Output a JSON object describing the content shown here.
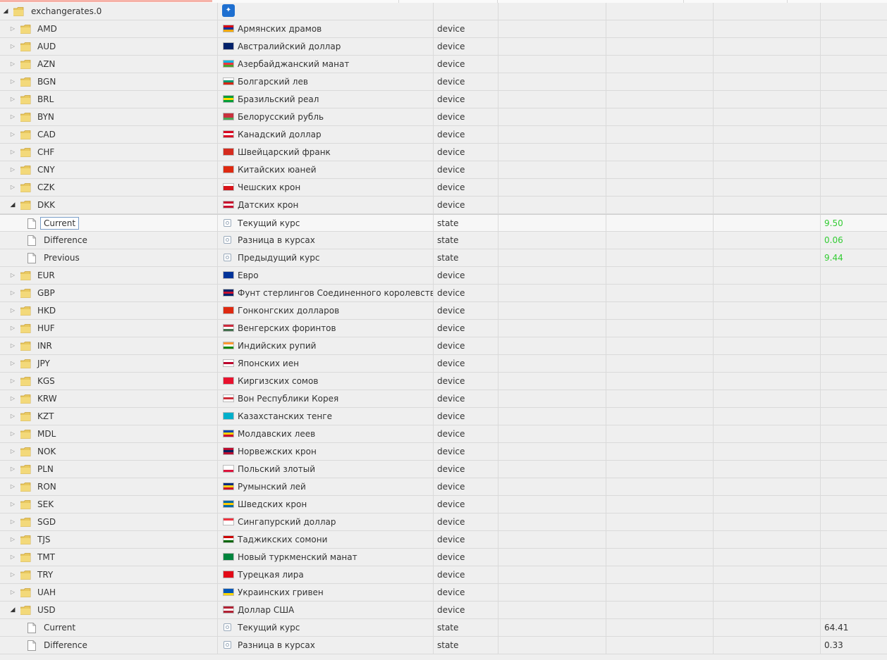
{
  "root": {
    "id": "exchangerates.0",
    "expanded": true
  },
  "colors": {
    "green_value": "#33cc33",
    "selection_border": "#7a9ec8"
  },
  "rows": [
    {
      "kind": "device",
      "id": "AMD",
      "name": "Армянских драмов",
      "type": "device",
      "flag": [
        "#d90012",
        "#0033a0",
        "#f2a800"
      ]
    },
    {
      "kind": "device",
      "id": "AUD",
      "name": "Австралийский доллар",
      "type": "device",
      "flag": [
        "#012169",
        "#012169",
        "#012169"
      ]
    },
    {
      "kind": "device",
      "id": "AZN",
      "name": "Азербайджанский манат",
      "type": "device",
      "flag": [
        "#00b5e2",
        "#ef3340",
        "#509e2f"
      ]
    },
    {
      "kind": "device",
      "id": "BGN",
      "name": "Болгарский лев",
      "type": "device",
      "flag": [
        "#ffffff",
        "#00966e",
        "#d62612"
      ]
    },
    {
      "kind": "device",
      "id": "BRL",
      "name": "Бразильский реал",
      "type": "device",
      "flag": [
        "#009c3b",
        "#ffdf00",
        "#009c3b"
      ]
    },
    {
      "kind": "device",
      "id": "BYN",
      "name": "Белорусский рубль",
      "type": "device",
      "flag": [
        "#c8313e",
        "#c8313e",
        "#4aa657"
      ]
    },
    {
      "kind": "device",
      "id": "CAD",
      "name": "Канадский доллар",
      "type": "device",
      "flag": [
        "#d80621",
        "#ffffff",
        "#d80621"
      ]
    },
    {
      "kind": "device",
      "id": "CHF",
      "name": "Швейцарский франк",
      "type": "device",
      "flag": [
        "#d52b1e",
        "#d52b1e",
        "#d52b1e"
      ]
    },
    {
      "kind": "device",
      "id": "CNY",
      "name": "Китайских юаней",
      "type": "device",
      "flag": [
        "#de2910",
        "#de2910",
        "#de2910"
      ]
    },
    {
      "kind": "device",
      "id": "CZK",
      "name": "Чешских крон",
      "type": "device",
      "flag": [
        "#ffffff",
        "#d7141a",
        "#d7141a"
      ]
    },
    {
      "kind": "device",
      "id": "DKK",
      "name": "Датских крон",
      "type": "device",
      "expanded": true,
      "flag": [
        "#c8102e",
        "#ffffff",
        "#c8102e"
      ]
    },
    {
      "kind": "state",
      "id": "Current",
      "name": "Текущий курс",
      "type": "state",
      "value": "9.50",
      "green": true,
      "selected": true
    },
    {
      "kind": "state",
      "id": "Difference",
      "name": "Разница в курсах",
      "type": "state",
      "value": "0.06",
      "green": true
    },
    {
      "kind": "state",
      "id": "Previous",
      "name": "Предыдущий курс",
      "type": "state",
      "value": "9.44",
      "green": true
    },
    {
      "kind": "device",
      "id": "EUR",
      "name": "Евро",
      "type": "device",
      "flag": [
        "#003399",
        "#003399",
        "#003399"
      ]
    },
    {
      "kind": "device",
      "id": "GBP",
      "name": "Фунт стерлингов Соединенного королевства",
      "type": "device",
      "flag": [
        "#012169",
        "#c8102e",
        "#012169"
      ]
    },
    {
      "kind": "device",
      "id": "HKD",
      "name": "Гонконгских долларов",
      "type": "device",
      "flag": [
        "#de2910",
        "#de2910",
        "#de2910"
      ]
    },
    {
      "kind": "device",
      "id": "HUF",
      "name": "Венгерских форинтов",
      "type": "device",
      "flag": [
        "#cd2a3e",
        "#ffffff",
        "#436f4d"
      ]
    },
    {
      "kind": "device",
      "id": "INR",
      "name": "Индийских рупий",
      "type": "device",
      "flag": [
        "#ff9933",
        "#ffffff",
        "#138808"
      ]
    },
    {
      "kind": "device",
      "id": "JPY",
      "name": "Японских иен",
      "type": "device",
      "flag": [
        "#ffffff",
        "#bc002d",
        "#ffffff"
      ]
    },
    {
      "kind": "device",
      "id": "KGS",
      "name": "Киргизских сомов",
      "type": "device",
      "flag": [
        "#e8112d",
        "#e8112d",
        "#e8112d"
      ]
    },
    {
      "kind": "device",
      "id": "KRW",
      "name": "Вон Республики Корея",
      "type": "device",
      "flag": [
        "#ffffff",
        "#cd2e3a",
        "#ffffff"
      ]
    },
    {
      "kind": "device",
      "id": "KZT",
      "name": "Казахстанских тенге",
      "type": "device",
      "flag": [
        "#00afca",
        "#00afca",
        "#00afca"
      ]
    },
    {
      "kind": "device",
      "id": "MDL",
      "name": "Молдавских леев",
      "type": "device",
      "flag": [
        "#0046ae",
        "#ffd200",
        "#cc092f"
      ]
    },
    {
      "kind": "device",
      "id": "NOK",
      "name": "Норвежских крон",
      "type": "device",
      "flag": [
        "#ba0c2f",
        "#00205b",
        "#ba0c2f"
      ]
    },
    {
      "kind": "device",
      "id": "PLN",
      "name": "Польский злотый",
      "type": "device",
      "flag": [
        "#ffffff",
        "#ffffff",
        "#dc143c"
      ]
    },
    {
      "kind": "device",
      "id": "RON",
      "name": "Румынский лей",
      "type": "device",
      "flag": [
        "#002b7f",
        "#fcd116",
        "#ce1126"
      ]
    },
    {
      "kind": "device",
      "id": "SEK",
      "name": "Шведских крон",
      "type": "device",
      "flag": [
        "#006aa7",
        "#fecc00",
        "#006aa7"
      ]
    },
    {
      "kind": "device",
      "id": "SGD",
      "name": "Сингапурский доллар",
      "type": "device",
      "flag": [
        "#ef3340",
        "#ffffff",
        "#ffffff"
      ]
    },
    {
      "kind": "device",
      "id": "TJS",
      "name": "Таджикских сомони",
      "type": "device",
      "flag": [
        "#cc0000",
        "#ffffff",
        "#006600"
      ]
    },
    {
      "kind": "device",
      "id": "TMT",
      "name": "Новый туркменский манат",
      "type": "device",
      "flag": [
        "#00843d",
        "#00843d",
        "#00843d"
      ]
    },
    {
      "kind": "device",
      "id": "TRY",
      "name": "Турецкая лира",
      "type": "device",
      "flag": [
        "#e30a17",
        "#e30a17",
        "#e30a17"
      ]
    },
    {
      "kind": "device",
      "id": "UAH",
      "name": "Украинских гривен",
      "type": "device",
      "flag": [
        "#0057b7",
        "#0057b7",
        "#ffd700"
      ]
    },
    {
      "kind": "device",
      "id": "USD",
      "name": "Доллар США",
      "type": "device",
      "expanded": true,
      "flag": [
        "#b22234",
        "#ffffff",
        "#b22234"
      ]
    },
    {
      "kind": "state",
      "id": "Current",
      "name": "Текущий курс",
      "type": "state",
      "value": "64.41"
    },
    {
      "kind": "state",
      "id": "Difference",
      "name": "Разница в курсах",
      "type": "state",
      "value": "0.33"
    }
  ]
}
